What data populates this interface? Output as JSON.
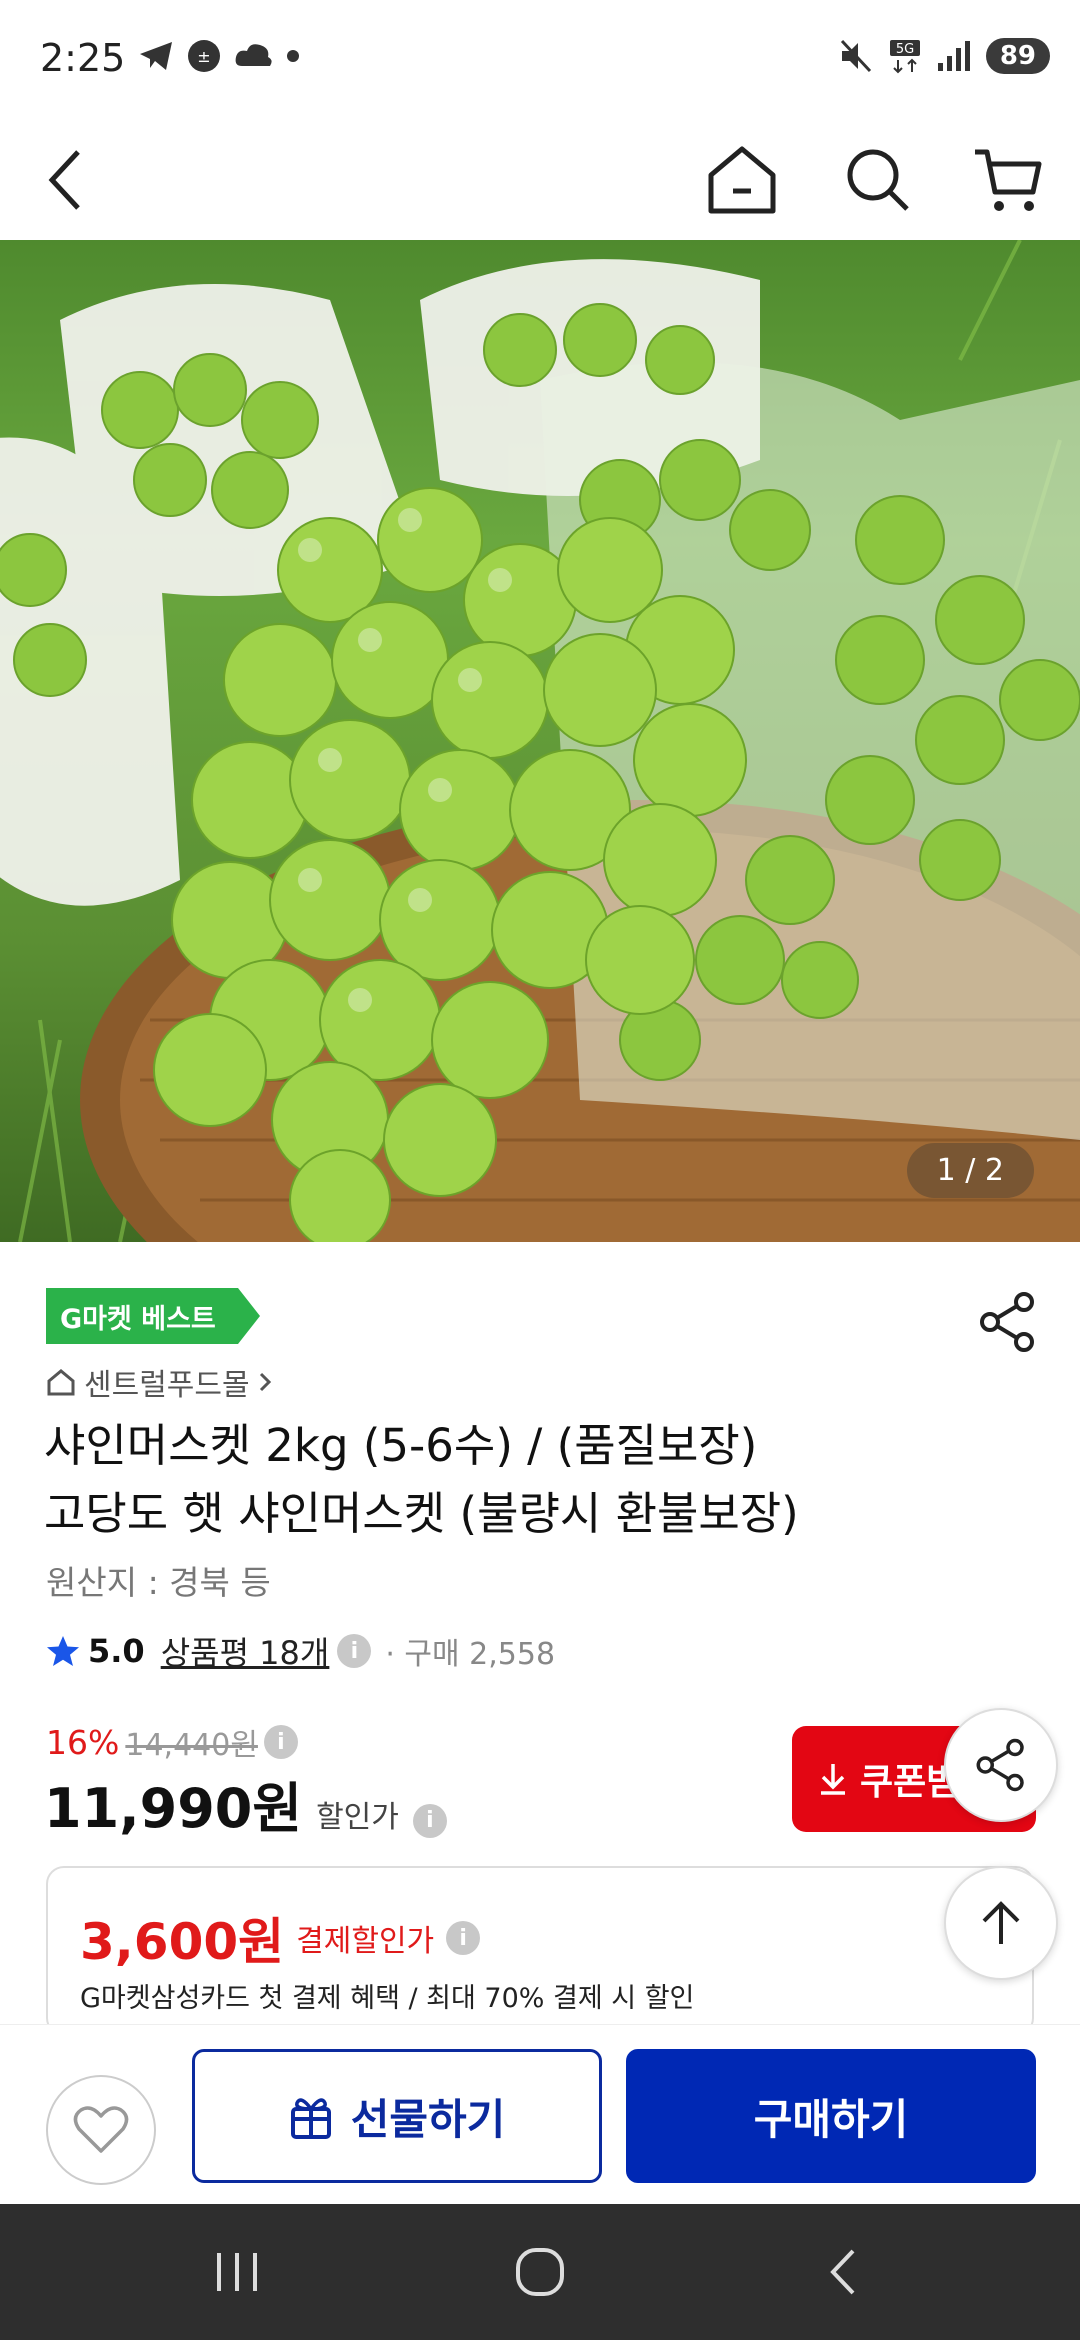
{
  "status_bar": {
    "time": "2:25",
    "battery": "89"
  },
  "product": {
    "image_indicator": "1 / 2",
    "badge": "G마켓 베스트",
    "store_name": "센트럴푸드몰",
    "title_line1": "샤인머스켓 2kg (5-6수) / (품질보장)",
    "title_line2": "고당도 햇 샤인머스켓 (불량시 환불보장)",
    "origin": "원산지 : 경북  등",
    "rating": "5.0",
    "review_count": "상품평 18개",
    "purchase_count": "· 구매 2,558",
    "discount_rate": "16%",
    "original_price": "14,440원",
    "sale_price": "11,990원",
    "sale_label": "할인가",
    "coupon_label": "쿠폰받"
  },
  "card_offer": {
    "amount": "3,600원",
    "label": "결제할인가",
    "description": "G마켓삼성카드 첫 결제 혜택 / 최대 70% 결제 시 할인"
  },
  "actions": {
    "gift_label": "선물하기",
    "buy_label": "구매하기"
  },
  "colors": {
    "brand_blue": "#0028b4",
    "coupon_red": "#e30613",
    "badge_green": "#2bb24a"
  }
}
